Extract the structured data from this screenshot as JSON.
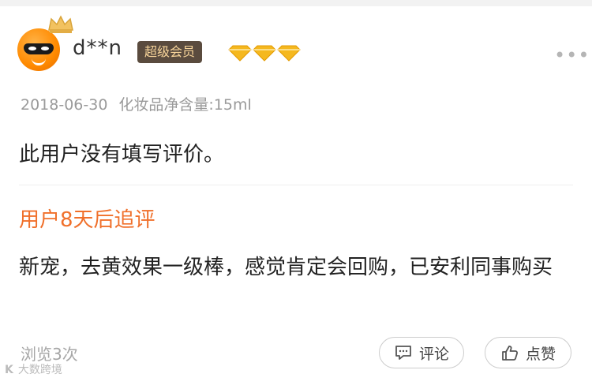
{
  "user": {
    "name": "d**n",
    "badge": "超级会员",
    "diamond_count": 3
  },
  "review": {
    "date": "2018-06-30",
    "spec": "化妆品净含量:15ml",
    "text": "此用户没有填写评价。"
  },
  "followup": {
    "title": "用户8天后追评",
    "text": "新宠，去黄效果一级棒，感觉肯定会回购，已安利同事购买"
  },
  "footer": {
    "views": "浏览3次",
    "comment_label": "评论",
    "like_label": "点赞"
  },
  "watermark": {
    "logo": "K",
    "text": "大数跨境"
  },
  "colors": {
    "accent": "#f0702b",
    "badge_bg": "#5a4b3e",
    "badge_text": "#f7d49a",
    "diamond": "#f5b81f"
  }
}
